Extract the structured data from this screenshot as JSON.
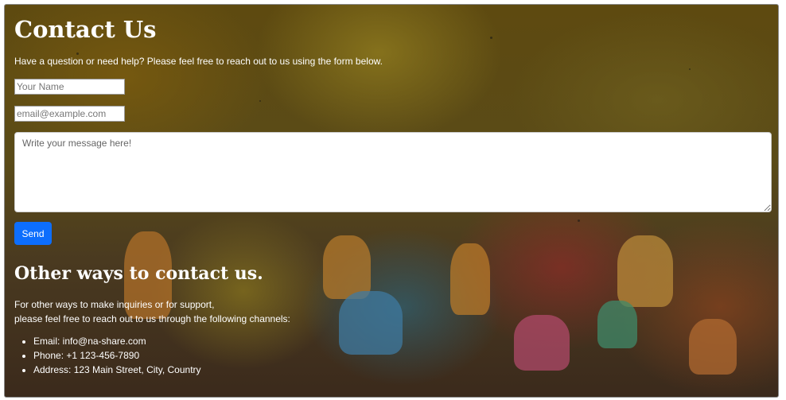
{
  "contact": {
    "title": "Contact Us",
    "intro": "Have a question or need help? Please feel free to reach out to us using the form below."
  },
  "form": {
    "name_placeholder": "Your Name",
    "email_placeholder": "email@example.com",
    "message_placeholder": "Write your message here!",
    "send_label": "Send"
  },
  "other": {
    "title": "Other ways to contact us.",
    "line1": "For other ways to make inquiries or for support,",
    "line2": "please feel free to reach out to us through the following channels:",
    "channels": [
      "Email: info@na-share.com",
      "Phone: +1 123-456-7890",
      "Address: 123 Main Street, City, Country"
    ]
  },
  "colors": {
    "accent": "#0d6efd",
    "text": "#ffffff"
  }
}
